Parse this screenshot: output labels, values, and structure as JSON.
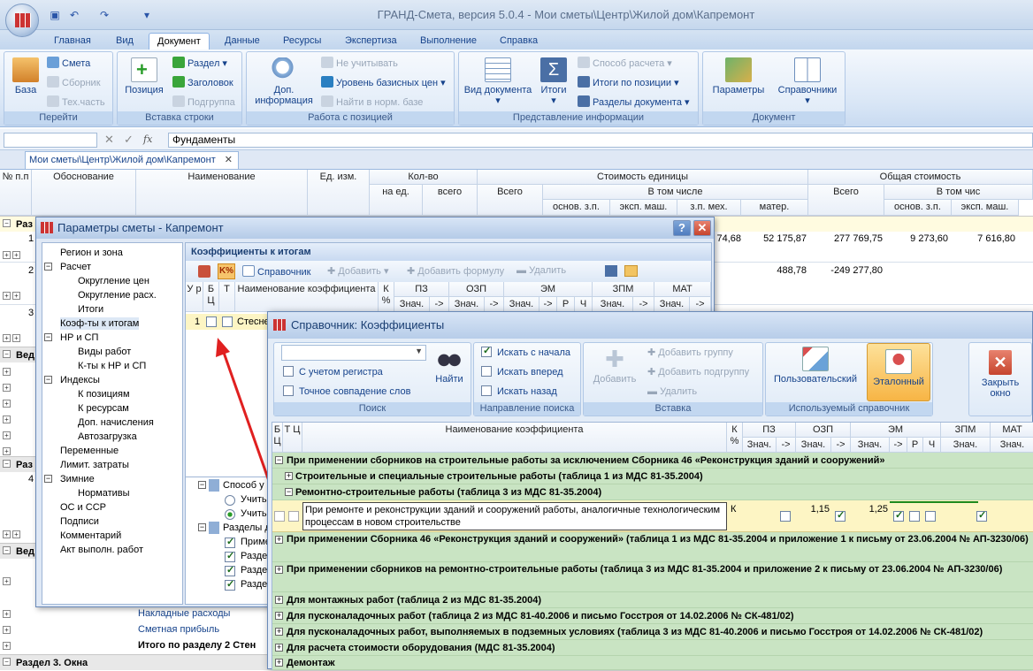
{
  "app": {
    "title": "ГРАНД-Смета, версия 5.0.4 - Мои сметы\\Центр\\Жилой дом\\Капремонт"
  },
  "tabs": [
    "Главная",
    "Вид",
    "Документ",
    "Данные",
    "Ресурсы",
    "Экспертиза",
    "Выполнение",
    "Справка"
  ],
  "ribbon": {
    "g1": {
      "caption": "Перейти",
      "big": "База",
      "s1": "Смета",
      "s2": "Сборник",
      "s3": "Тех.часть"
    },
    "g2": {
      "caption": "Вставка строки",
      "big": "Позиция",
      "s1": "Раздел",
      "s2": "Заголовок",
      "s3": "Подгруппа"
    },
    "g3": {
      "caption": "Работа с позицией",
      "big": "Доп. информация",
      "s1": "Не учитывать",
      "s2": "Уровень базисных цен",
      "s3": "Найти в норм. базе"
    },
    "g4": {
      "caption": "Представление информации",
      "big1": "Вид документа",
      "big2": "Итоги",
      "s1": "Способ расчета",
      "s2": "Итоги по позиции",
      "s3": "Разделы документа"
    },
    "g5": {
      "caption": "Документ",
      "big1": "Параметры",
      "big2": "Справочники"
    }
  },
  "formula": {
    "value": "Фундаменты"
  },
  "doc_tab": "Мои сметы\\Центр\\Жилой дом\\Капремонт",
  "grid": {
    "h": {
      "np": "№ п.п",
      "obosn": "Обоснование",
      "name": "Наименование",
      "ed": "Ед. изм.",
      "kol": "Кол-во",
      "naed": "на ед.",
      "vsego": "всего",
      "stoim": "Стоимость единицы",
      "vsego2": "Всего",
      "vtch": "В том числе",
      "osn": "основ. з.п.",
      "eksp": "эксп. маш.",
      "zpmeh": "з.п. мех.",
      "mater": "матер.",
      "obsh": "Общая стоимость",
      "vsego3": "Всего",
      "vtch2": "В том чис",
      "osn2": "основ. з.п.",
      "eksp2": "эксп. маш."
    },
    "rows": {
      "r1": "1",
      "r2": "2",
      "r3": "3",
      "r4": "4",
      "v1a": "74,68",
      "v1b": "52 175,87",
      "v1c": "277 769,75",
      "v1d": "9 273,60",
      "v1e": "7 616,80",
      "v2a": "488,78",
      "v2b": "-249 277,80"
    },
    "sections": {
      "s1": "Раз",
      "s2": "Вед",
      "s3": "Раз",
      "s4": "Вед",
      "s5": "Раздел 3. Окна"
    },
    "links": {
      "l1": "Накладные расходы",
      "l2": "Сметная прибыль",
      "l3": "Итого по разделу 2 Стен"
    }
  },
  "dlg1": {
    "title": "Параметры сметы - Капремонт",
    "tree": [
      "Регион и зона",
      "Расчет",
      "Округление цен",
      "Округление расх.",
      "Итоги",
      "Коэф-ты к итогам",
      "НР и СП",
      "Виды работ",
      "К-ты к НР и СП",
      "Индексы",
      "К позициям",
      "К ресурсам",
      "Доп. начисления",
      "Автозагрузка",
      "Переменные",
      "Лимит. затраты",
      "Зимние",
      "Нормативы",
      "ОС и ССР",
      "Подписи",
      "Комментарий",
      "Акт выполн. работ"
    ],
    "panel_title": "Коэффициенты к итогам",
    "tb": {
      "spr": "Справочник",
      "add": "Добавить",
      "addf": "Добавить формулу",
      "del": "Удалить"
    },
    "cols": {
      "u": "У р",
      "b": "Б Ц",
      "t": "Т",
      "name": "Наименование коэффициента",
      "k": "К %",
      "pz": "ПЗ",
      "ozp": "ОЗП",
      "em": "ЭМ",
      "zpm": "ЗПМ",
      "mat": "МАТ",
      "zn": "Знач.",
      "ar": "->",
      "r": "Р",
      "ch": "Ч"
    },
    "row1": {
      "u": "1",
      "name": "Стеснен"
    },
    "lower": {
      "sposob": "Способ у",
      "uch1": "Учить",
      "uch2": "Учить",
      "razd": "Разделы д",
      "prim": "Приме",
      "r1": "Разде",
      "r2": "Разде",
      "r3": "Разде"
    }
  },
  "dlg2": {
    "title": "Справочник: Коэффициенты",
    "search": {
      "caption": "Поиск",
      "reg": "С учетом регистра",
      "exact": "Точное совпадение слов",
      "find": "Найти"
    },
    "dir": {
      "caption": "Направление поиска",
      "start": "Искать с начала",
      "fwd": "Искать вперед",
      "back": "Искать назад"
    },
    "ins": {
      "caption": "Вставка",
      "add": "Добавить",
      "addg": "Добавить группу",
      "addsg": "Добавить подгруппу",
      "del": "Удалить"
    },
    "used": {
      "caption": "Используемый справочник",
      "user": "Пользовательский",
      "std": "Эталонный"
    },
    "close": "Закрыть окно",
    "cols": {
      "b": "Б Ц",
      "t": "Т Ц",
      "name": "Наименование коэффициента",
      "k": "К %",
      "pz": "ПЗ",
      "ozp": "ОЗП",
      "em": "ЭМ",
      "zpm": "ЗПМ",
      "mat": "МАТ",
      "zn": "Знач.",
      "ar": "->",
      "r": "Р",
      "ch": "Ч"
    },
    "groups": [
      "При применении сборников на строительные работы за исключением Сборника 46 «Реконструкция зданий и сооружений»",
      "Строительные и специальные строительные работы (таблица 1 из МДС 81-35.2004)",
      "Ремонтно-строительные работы (таблица 3 из МДС 81-35.2004)",
      "При применении Сборника 46 «Реконструкция зданий и сооружений» (таблица 1 из МДС 81-35.2004 и приложение 1 к письму от 23.06.2004 № АП-3230/06)",
      "При применении сборников на ремонтно-строительные работы (таблица 3 из МДС 81-35.2004 и приложение 2 к письму от 23.06.2004 № АП-3230/06)",
      "Для монтажных работ (таблица 2 из МДС 81-35.2004)",
      "Для пусконаладочных работ (таблица 2 из МДС 81-40.2006 и письмо Госстроя от 14.02.2006 № СК-481/02)",
      "Для пусконаладочных работ, выполняемых в подземных условиях (таблица 3 из МДС 81-40.2006 и письмо Госстроя от 14.02.2006 № СК-481/02)",
      "Для расчета стоимости оборудования (МДС 81-35.2004)",
      "Демонтаж"
    ],
    "item": {
      "name": "При ремонте и реконструкции зданий и сооружений работы, аналогичные технологическим процессам в новом строительстве",
      "k": "К",
      "ozp": "1,15",
      "em": "1,25"
    }
  },
  "colors": {
    "accent": "#15428b",
    "highlight": "#fdf5c4",
    "group": "#c9e4c3",
    "arrow": "#e02020"
  }
}
